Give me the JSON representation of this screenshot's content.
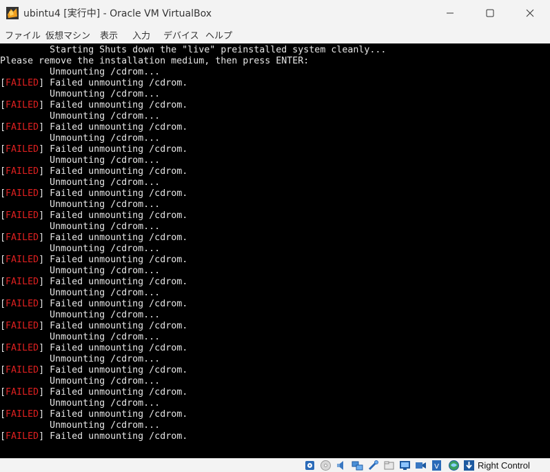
{
  "window": {
    "title": "ubintu4 [実行中] - Oracle VM VirtualBox"
  },
  "menu": [
    {
      "label": "ファイル"
    },
    {
      "label": "仮想マシン"
    },
    {
      "label": "表示"
    },
    {
      "label": "入力"
    },
    {
      "label": "デバイス"
    },
    {
      "label": "ヘルプ"
    }
  ],
  "console": {
    "colors": {
      "background": "#000000",
      "text": "#e6e6e6",
      "failed": "#e02020"
    },
    "starting_line": "         Starting Shuts down the \"live\" preinstalled system cleanly...",
    "prompt_line": "Please remove the installation medium, then press ENTER:",
    "unmount_text": "         Unmounting /cdrom...",
    "failed_tag": "FAILED",
    "failed_text": " Failed unmounting /cdrom.",
    "fail_count": 17
  },
  "statusbar": {
    "host_key": "Right Control",
    "icons": [
      "hard-disk-icon",
      "optical-drive-icon",
      "audio-icon",
      "network-icon",
      "usb-icon",
      "shared-folder-icon",
      "display-icon",
      "video-capture-icon",
      "cpu-icon",
      "mouse-integration-icon",
      "keyboard-capture-icon"
    ]
  }
}
